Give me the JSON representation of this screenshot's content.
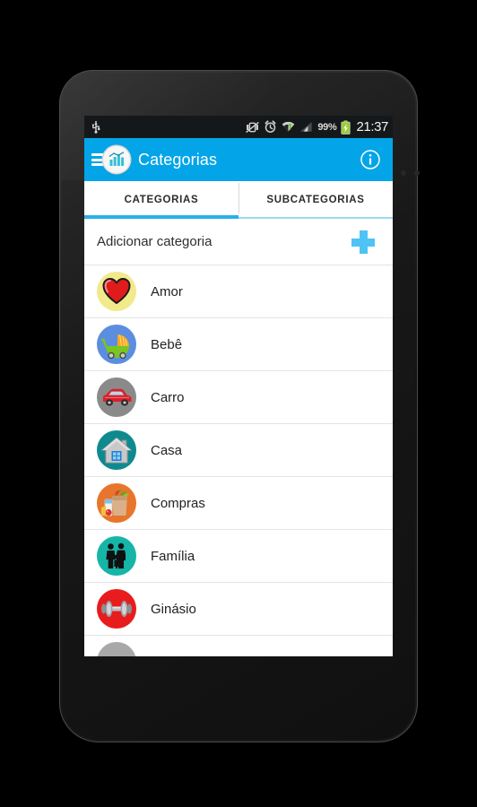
{
  "theme": {
    "accent": "#03a5e8",
    "accent_light": "#4ec3f5",
    "tab_underline": "#28b0e8",
    "statusbar_bg": "#15181a",
    "screen_bg": "#ffffff"
  },
  "statusbar": {
    "usb_icon": "usb-icon",
    "vibrate_off_icon": "vibrate-off-icon",
    "alarm_icon": "alarm-clock-icon",
    "wifi_icon": "wifi-icon",
    "signal_icon": "cellular-signal-icon",
    "battery_percent": "99%",
    "battery_icon": "battery-charging-icon",
    "clock": "21:37"
  },
  "appbar": {
    "menu_icon": "hamburger-menu-icon",
    "logo_icon": "bar-chart-logo-icon",
    "title": "Categorias",
    "info_icon": "info-icon"
  },
  "tabs": [
    {
      "label": "CATEGORIAS",
      "active": true
    },
    {
      "label": "SUBCATEGORIAS",
      "active": false
    }
  ],
  "add_row": {
    "label": "Adicionar categoria",
    "button_icon": "plus-icon"
  },
  "categories": [
    {
      "name": "Amor",
      "icon": "heart-icon",
      "bg": "#f2e98a"
    },
    {
      "name": "Bebê",
      "icon": "stroller-icon",
      "bg": "#5b8ee0"
    },
    {
      "name": "Carro",
      "icon": "car-icon",
      "bg": "#8a8a8a"
    },
    {
      "name": "Casa",
      "icon": "house-icon",
      "bg": "#0e8a8f"
    },
    {
      "name": "Compras",
      "icon": "shopping-bag-icon",
      "bg": "#e8752c"
    },
    {
      "name": "Família",
      "icon": "family-icon",
      "bg": "#16b5a8"
    },
    {
      "name": "Ginásio",
      "icon": "dumbbell-icon",
      "bg": "#e81c1c"
    },
    {
      "name": "",
      "icon": "partial-icon",
      "bg": "#a8a8a8"
    }
  ]
}
